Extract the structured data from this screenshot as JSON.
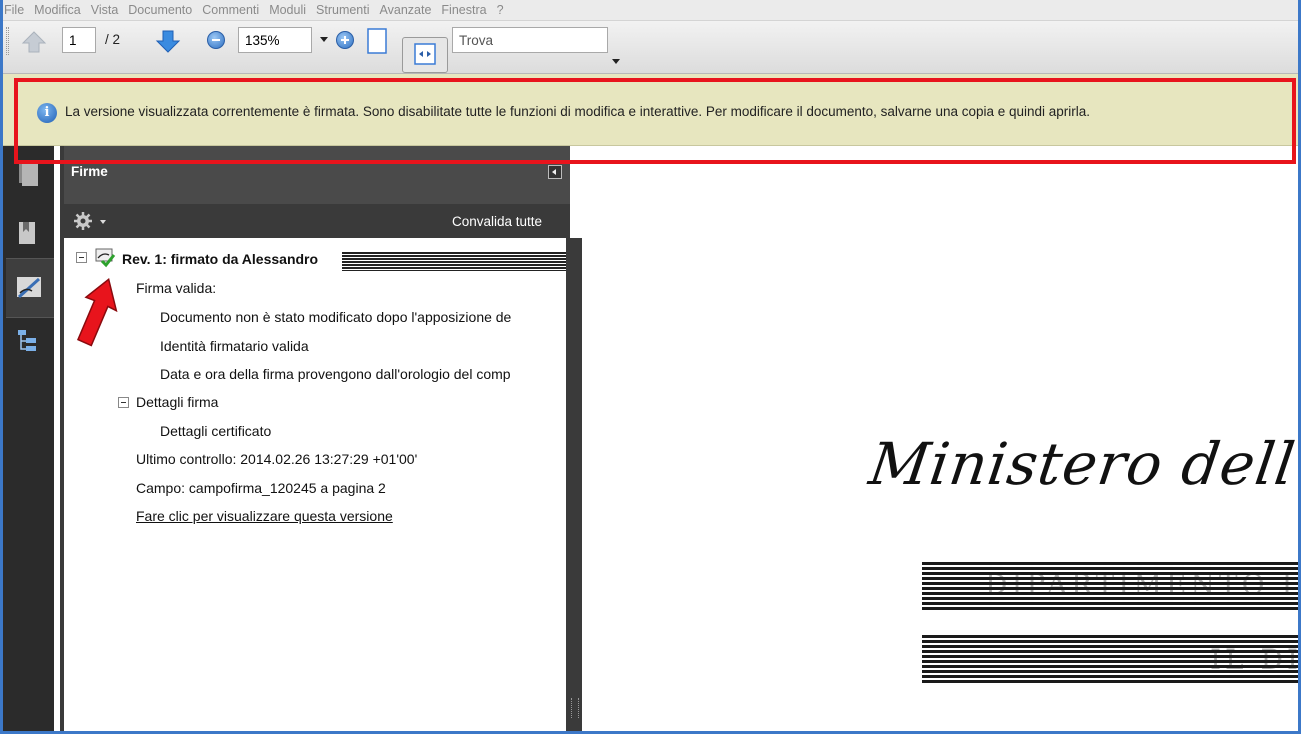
{
  "menu": [
    "File",
    "Modifica",
    "Vista",
    "Documento",
    "Commenti",
    "Moduli",
    "Strumenti",
    "Avanzate",
    "Finestra",
    "?"
  ],
  "toolbar": {
    "page_current": "1",
    "page_total": "/ 2",
    "zoom": "135%",
    "search_placeholder": "Trova"
  },
  "infobar": {
    "message": "La versione visualizzata correntemente è firmata. Sono disabilitate tutte le funzioni di modifica e interattive. Per modificare il documento, salvarne una copia e quindi aprirla."
  },
  "panel": {
    "title": "Firme",
    "validate_all": "Convalida tutte",
    "signature_title": "Rev. 1: firmato da Alessandro",
    "valid_label": "Firma valida:",
    "detail_unmodified": "Documento non è stato modificato dopo l'apposizione de",
    "detail_identity": "Identità firmatario valida",
    "detail_time": "Data e ora della firma provengono dall'orologio del comp",
    "details_section": "Dettagli firma",
    "cert_details": "Dettagli certificato",
    "last_check": "Ultimo controllo: 2014.02.26 13:27:29 +01'00'",
    "field": "Campo: campofirma_120245 a pagina 2",
    "view_version_link": "Fare clic per visualizzare questa versione"
  },
  "document": {
    "heading": "Ministero dell' E",
    "line1": "DIPARTIMENTO I",
    "line2": "IL DI"
  },
  "colors": {
    "infobar_bg": "#e7e6bf",
    "highlight_red": "#e8141c",
    "panel_dark": "#3a3a3a",
    "frame_blue": "#3c78c8"
  }
}
